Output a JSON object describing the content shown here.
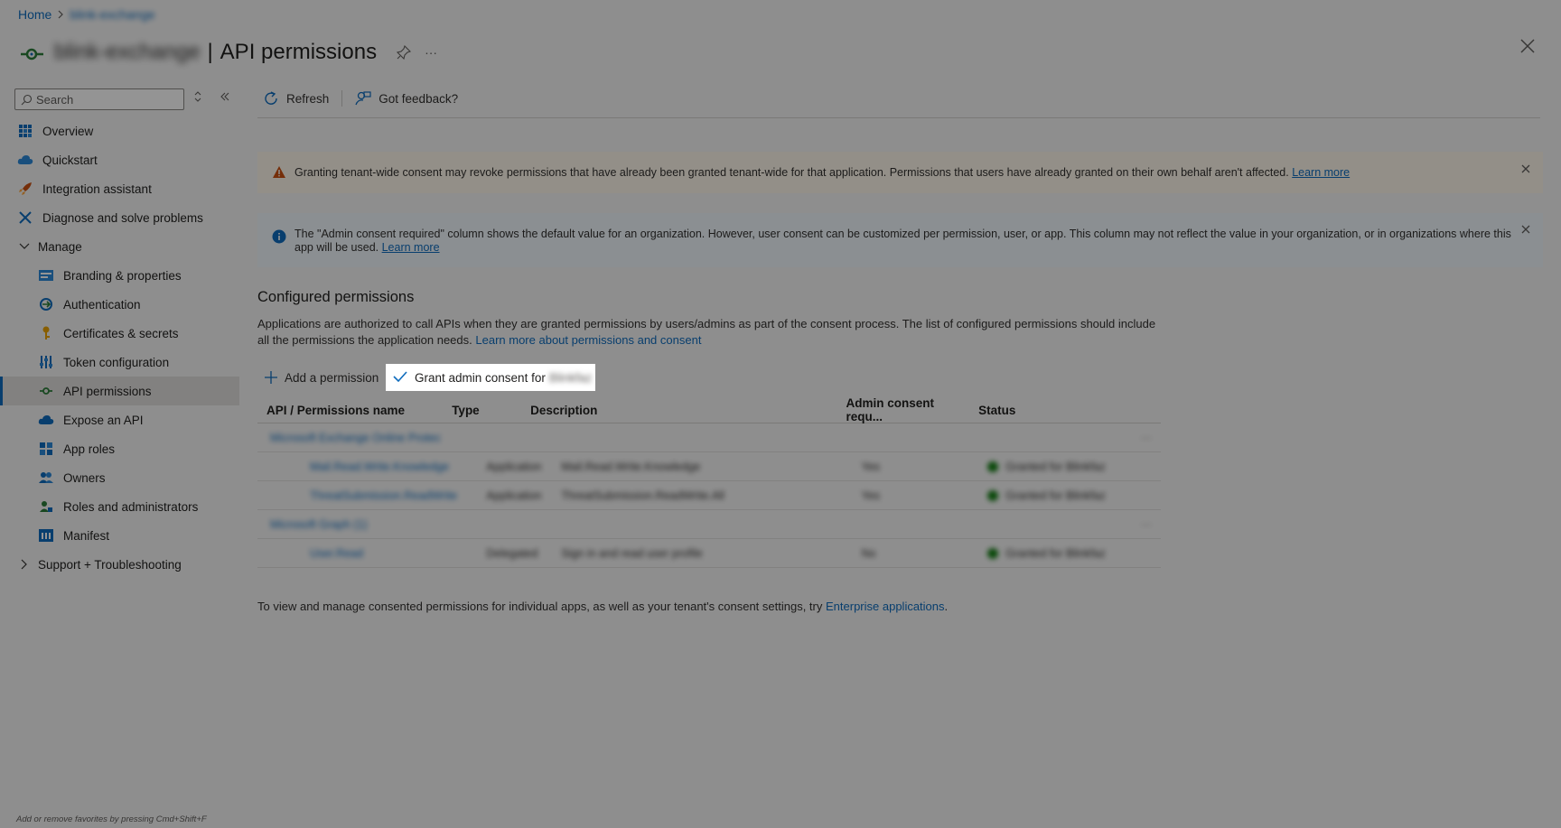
{
  "breadcrumb": {
    "home": "Home",
    "current": "blink-exchange"
  },
  "header": {
    "app_name": "blink-exchange",
    "separator": "|",
    "title": "API permissions",
    "more": "···"
  },
  "sidebar": {
    "search_placeholder": "Search",
    "items": [
      {
        "label": "Overview",
        "icon": "grid-icon"
      },
      {
        "label": "Quickstart",
        "icon": "cloud-icon"
      },
      {
        "label": "Integration assistant",
        "icon": "rocket-icon"
      },
      {
        "label": "Diagnose and solve problems",
        "icon": "wrench-icon"
      },
      {
        "label": "Manage",
        "icon": "chevron-down-icon"
      },
      {
        "label": "Branding & properties",
        "icon": "branding-icon"
      },
      {
        "label": "Authentication",
        "icon": "auth-icon"
      },
      {
        "label": "Certificates & secrets",
        "icon": "key-icon"
      },
      {
        "label": "Token configuration",
        "icon": "token-icon"
      },
      {
        "label": "API permissions",
        "icon": "api-permissions-icon"
      },
      {
        "label": "Expose an API",
        "icon": "cloud-api-icon"
      },
      {
        "label": "App roles",
        "icon": "app-roles-icon"
      },
      {
        "label": "Owners",
        "icon": "owners-icon"
      },
      {
        "label": "Roles and administrators",
        "icon": "roles-icon"
      },
      {
        "label": "Manifest",
        "icon": "manifest-icon"
      },
      {
        "label": "Support + Troubleshooting",
        "icon": "chevron-right-icon"
      }
    ],
    "favorites_hint": "Add or remove favorites by pressing Cmd+Shift+F"
  },
  "toolbar": {
    "refresh": "Refresh",
    "feedback": "Got feedback?"
  },
  "warning": {
    "text": "Granting tenant-wide consent may revoke permissions that have already been granted tenant-wide for that application. Permissions that users have already granted on their own behalf aren't affected.",
    "link": "Learn more"
  },
  "info": {
    "text": "The \"Admin consent required\" column shows the default value for an organization. However, user consent can be customized per permission, user, or app. This column may not reflect the value in your organization, or in organizations where this app will be used.",
    "link": "Learn more"
  },
  "configured": {
    "title": "Configured permissions",
    "desc": "Applications are authorized to call APIs when they are granted permissions by users/admins as part of the consent process. The list of configured permissions should include all the permissions the application needs.",
    "link": "Learn more about permissions and consent"
  },
  "actions": {
    "add": "Add a permission",
    "grant": "Grant admin consent for",
    "grant_org": "Blinkfaz"
  },
  "table": {
    "headers": [
      "API / Permissions name",
      "Type",
      "Description",
      "Admin consent requ...",
      "Status"
    ],
    "groups": [
      {
        "name": "Microsoft Exchange Online Protec",
        "rows": [
          {
            "name": "Mail.Read.Write.Knowledge",
            "type": "Application",
            "desc": "Mail.Read.Write.Knowledge",
            "admin": "Yes",
            "status": "Granted for Blinkfaz"
          },
          {
            "name": "ThreatSubmission.ReadWrite",
            "type": "Application",
            "desc": "ThreatSubmission.ReadWrite.All",
            "admin": "Yes",
            "status": "Granted for Blinkfaz"
          }
        ]
      },
      {
        "name": "Microsoft Graph (1)",
        "rows": [
          {
            "name": "User.Read",
            "type": "Delegated",
            "desc": "Sign in and read user profile",
            "admin": "No",
            "status": "Granted for Blinkfaz"
          }
        ]
      }
    ]
  },
  "footer": {
    "text": "To view and manage consented permissions for individual apps, as well as your tenant's consent settings, try",
    "link": "Enterprise applications",
    "end": "."
  }
}
